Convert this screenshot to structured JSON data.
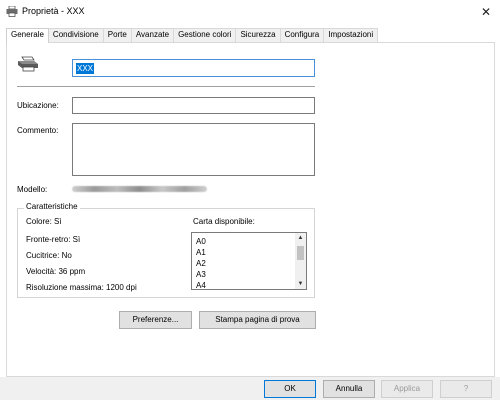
{
  "window": {
    "title": "Proprietà - XXX",
    "close_glyph": "✕"
  },
  "tabs": [
    {
      "label": "Generale",
      "active": true
    },
    {
      "label": "Condivisione"
    },
    {
      "label": "Porte"
    },
    {
      "label": "Avanzate"
    },
    {
      "label": "Gestione colori"
    },
    {
      "label": "Sicurezza"
    },
    {
      "label": "Configura"
    },
    {
      "label": "Impostazioni"
    }
  ],
  "general": {
    "printer_name": "XXX",
    "location_label": "Ubicazione:",
    "location_value": "",
    "comment_label": "Commento:",
    "comment_value": "",
    "model_label": "Modello:"
  },
  "features": {
    "group_title": "Caratteristiche",
    "color": "Colore: Sì",
    "duplex": "Fronte-retro: Sì",
    "staple": "Cucitrice: No",
    "speed": "Velocità: 36 ppm",
    "resolution": "Risoluzione massima: 1200 dpi",
    "paper_label": "Carta disponibile:",
    "paper_list": [
      "A0",
      "A1",
      "A2",
      "A3",
      "A4"
    ]
  },
  "buttons": {
    "preferences": "Preferenze...",
    "test_page": "Stampa pagina di prova",
    "ok": "OK",
    "cancel": "Annulla",
    "apply": "Applica",
    "help": "?"
  },
  "icons": {
    "window": "printer-icon",
    "printer": "printer-icon",
    "scroll_up": "chevron-up-icon",
    "scroll_down": "chevron-down-icon"
  }
}
